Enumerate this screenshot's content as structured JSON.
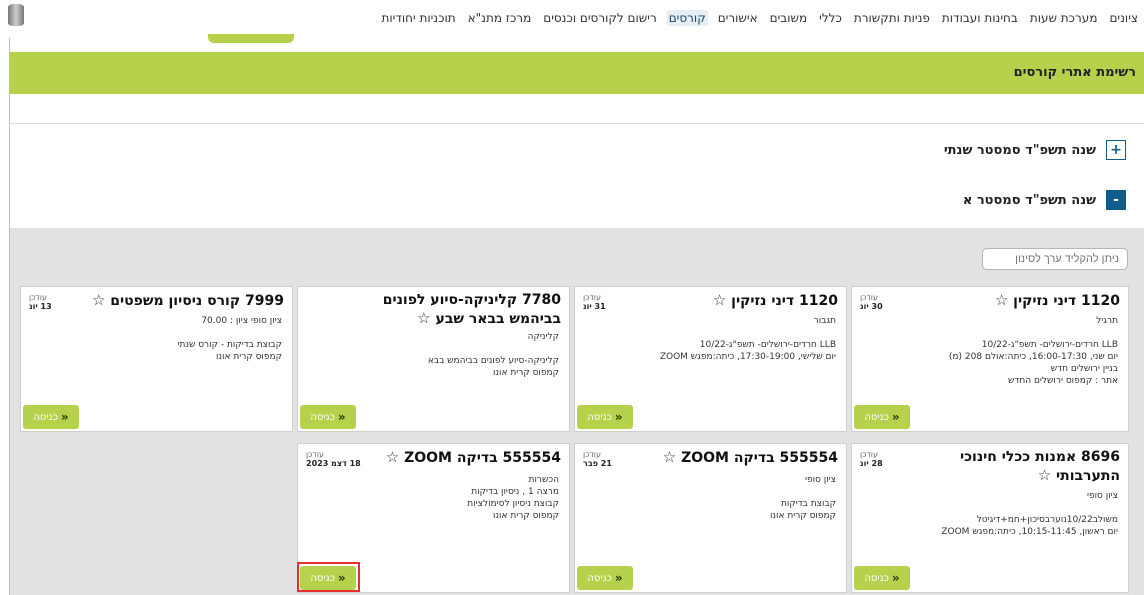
{
  "nav": {
    "items": [
      "ציונים",
      "מערכת שעות",
      "בחינות ועבודות",
      "פניות ותקשורת",
      "כללי",
      "משובים",
      "אישורים",
      "קורסים",
      "רישום לקורסים וכנסים",
      "מרכז מתנ\"א",
      "תוכניות יחודיות"
    ],
    "active_index": 7
  },
  "page_title": "רשימת אתרי קורסים",
  "years": [
    {
      "label": "שנה תשפ\"ד  סמסטר שנתי",
      "toggle": "+"
    },
    {
      "label": "שנה תשפ\"ד  סמסטר א",
      "toggle": "-"
    }
  ],
  "filter_placeholder": "ניתן להקליד ערך לסינון",
  "updated_label": "עודכן",
  "enter_label": "כניסה",
  "enter_icon": "«",
  "star_icon": "☆",
  "cards": [
    {
      "title": "1120 דיני נזיקין",
      "date": "30 יונ",
      "lines": [
        "תרגיל",
        "",
        "LLB חרדים-ירושלים- תשפ\"ג-10/22",
        "יום שני, 16:00-17:30, כיתה:אולם 208 (מ)",
        "בניין ירושלים חדש",
        "אתר : קמפוס ירושלים החדש"
      ]
    },
    {
      "title": "1120 דיני נזיקין",
      "date": "31 יונ",
      "lines": [
        "תגבור",
        "",
        "LLB חרדים-ירושלים- תשפ\"ג-10/22",
        "יום שלישי, 17:30-19:00, כיתה:מפגש ZOOM"
      ]
    },
    {
      "title": "7780 קליניקה-סיוע לפונים בביהמש בבאר שבע",
      "date": "",
      "lines": [
        "קליניקה",
        "",
        "קליניקה-סיוע לפונים בביהמש בבא",
        "קמפוס קרית אונו"
      ]
    },
    {
      "title": "7999 קורס ניסיון משפטים",
      "date": "13 יונ",
      "lines": [
        "ציון סופי ציון : 70.00",
        "",
        "קבוצת בדיקות - קורס שנתי",
        "קמפוס קרית אונו"
      ]
    },
    {
      "title": "8696 אמנות ככלי חינוכי התערבותי",
      "date": "28 יונ",
      "lines": [
        "ציון סופי",
        "",
        "משולב10/22נוערבסיכון+חמ+דיגיטל",
        "יום ראשון, 10:15-11:45, כיתה:מפגש ZOOM"
      ]
    },
    {
      "title": "555554 בדיקה ZOOM",
      "date": "21 פבר",
      "lines": [
        "ציון סופי",
        "",
        "קבוצת בדיקות",
        "קמפוס קרית אונו"
      ]
    },
    {
      "title": "555554 בדיקה ZOOM",
      "date": "18 דצמ 2023",
      "lines": [
        "הכשרות",
        "מרצה 1 , ניסיון בדיקות",
        "קבוצת ניסיון לסימולציות",
        "קמפוס קרית אונו"
      ]
    }
  ]
}
